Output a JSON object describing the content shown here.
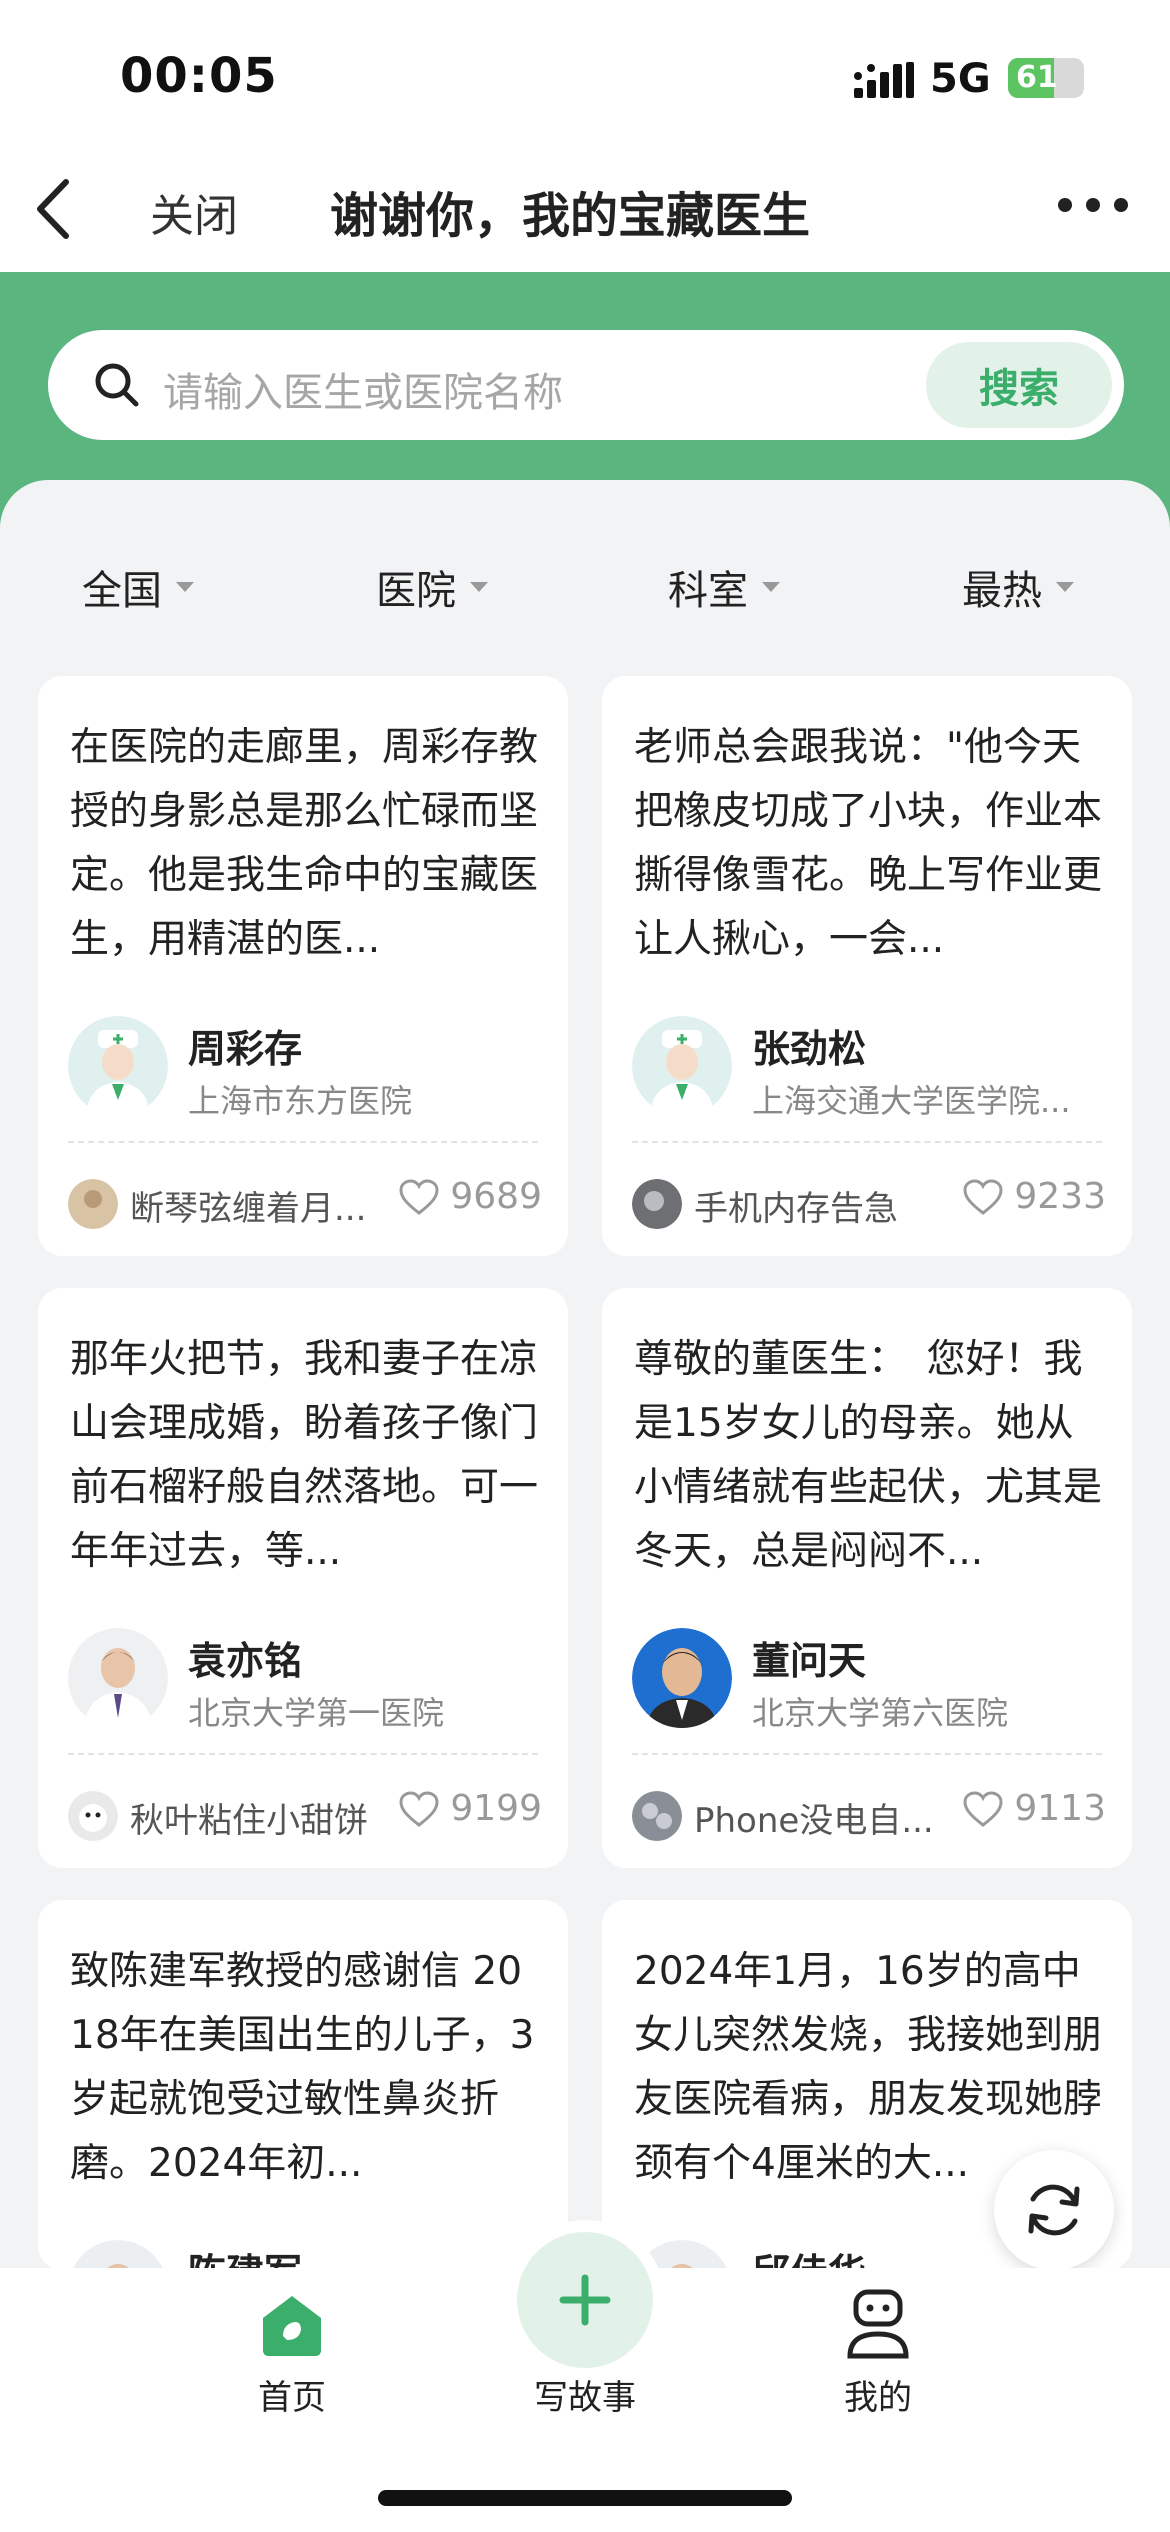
{
  "status_bar": {
    "time": "00:05",
    "network": "5G",
    "battery": "61",
    "battery_level": 0.61
  },
  "nav": {
    "close_label": "关闭",
    "title": "谢谢你，我的宝藏医生"
  },
  "search": {
    "placeholder": "请输入医生或医院名称",
    "button_label": "搜索"
  },
  "filters": [
    "全国",
    "医院",
    "科室",
    "最热"
  ],
  "colors": {
    "brand_green": "#5ab57f",
    "accent_green": "#3bae6b",
    "button_tint": "#e3f2e9"
  },
  "cards": [
    {
      "text": "在医院的走廊里，周彩存教授的身影总是那么忙碌而坚定。他是我生命中的宝藏医生，用精湛的医...",
      "doctor_name": "周彩存",
      "hospital": "上海市东方医院",
      "doctor_avatar": "doctor-placeholder-icon",
      "user_name": "断琴弦缠着月...",
      "likes": "9689"
    },
    {
      "text": "老师总会跟我说：\"他今天把橡皮切成了小块，作业本撕得像雪花。晚上写作业更让人揪心，一会...",
      "doctor_name": "张劲松",
      "hospital": "上海交通大学医学院...",
      "doctor_avatar": "doctor-placeholder-icon",
      "user_name": "手机内存告急",
      "likes": "9233"
    },
    {
      "text": "那年火把节，我和妻子在凉山会理成婚，盼着孩子像门前石榴籽般自然落地。可一年年过去，等...",
      "doctor_name": "袁亦铭",
      "hospital": "北京大学第一医院",
      "doctor_avatar": "doctor-photo",
      "user_name": "秋叶粘住小甜饼",
      "likes": "9199"
    },
    {
      "text": "尊敬的董医生：　您好！我是15岁女儿的母亲。她从小情绪就有些起伏，尤其是冬天，总是闷闷不...",
      "doctor_name": "董问天",
      "hospital": "北京大学第六医院",
      "doctor_avatar": "doctor-photo",
      "user_name": "Phone没电自...",
      "likes": "9113"
    },
    {
      "text": "致陈建军教授的感谢信 2018年在美国出生的儿子，3岁起就饱受过敏性鼻炎折磨。2024年初...",
      "doctor_name": "陈建军",
      "hospital": "",
      "doctor_avatar": "doctor-photo",
      "user_name": "",
      "likes": ""
    },
    {
      "text": "2024年1月，16岁的高中女儿突然发烧，我接她到朋友医院看病，朋友发现她脖颈有个4厘米的大...",
      "doctor_name": "邱佳华",
      "hospital": "",
      "doctor_avatar": "doctor-photo",
      "user_name": "",
      "likes": ""
    }
  ],
  "tabbar": {
    "home_label": "首页",
    "write_label": "写故事",
    "mine_label": "我的"
  }
}
